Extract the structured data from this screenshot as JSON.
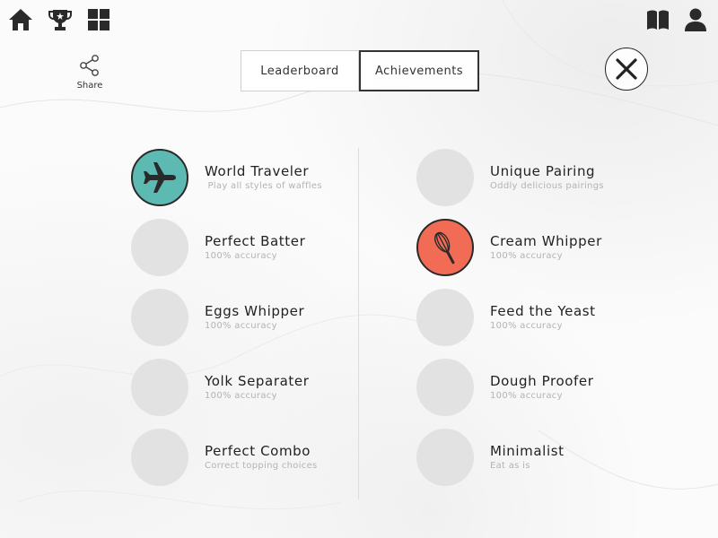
{
  "nav": {
    "home_icon": "home-icon",
    "trophy_icon": "trophy-icon",
    "grid_icon": "grid-icon",
    "book_icon": "book-icon",
    "profile_icon": "profile-icon"
  },
  "share": {
    "label": "Share",
    "icon": "share-icon"
  },
  "tabs": [
    {
      "label": "Leaderboard",
      "active": false
    },
    {
      "label": "Achievements",
      "active": true
    }
  ],
  "close": {
    "icon": "close-icon"
  },
  "colors": {
    "teal": "#5dbab3",
    "coral": "#f26c55",
    "locked": "#e2e2e2",
    "dark": "#2a2a2a"
  },
  "achievements": {
    "left": [
      {
        "title": "World Traveler",
        "desc": " Play all styles of waffles",
        "icon": "airplane-icon",
        "unlocked": true,
        "color": "#5dbab3"
      },
      {
        "title": "Perfect Batter",
        "desc": "100% accuracy",
        "unlocked": false
      },
      {
        "title": "Eggs Whipper",
        "desc": "100% accuracy",
        "unlocked": false
      },
      {
        "title": "Yolk Separater",
        "desc": "100% accuracy",
        "unlocked": false
      },
      {
        "title": "Perfect Combo",
        "desc": "Correct topping choices",
        "unlocked": false
      }
    ],
    "right": [
      {
        "title": "Unique Pairing",
        "desc": "Oddly delicious pairings",
        "unlocked": false
      },
      {
        "title": "Cream Whipper",
        "desc": "100% accuracy",
        "icon": "whisk-icon",
        "unlocked": true,
        "color": "#f26c55"
      },
      {
        "title": "Feed the Yeast",
        "desc": "100% accuracy",
        "unlocked": false
      },
      {
        "title": "Dough Proofer",
        "desc": "100% accuracy",
        "unlocked": false
      },
      {
        "title": "Minimalist",
        "desc": "Eat as is",
        "unlocked": false
      }
    ]
  }
}
